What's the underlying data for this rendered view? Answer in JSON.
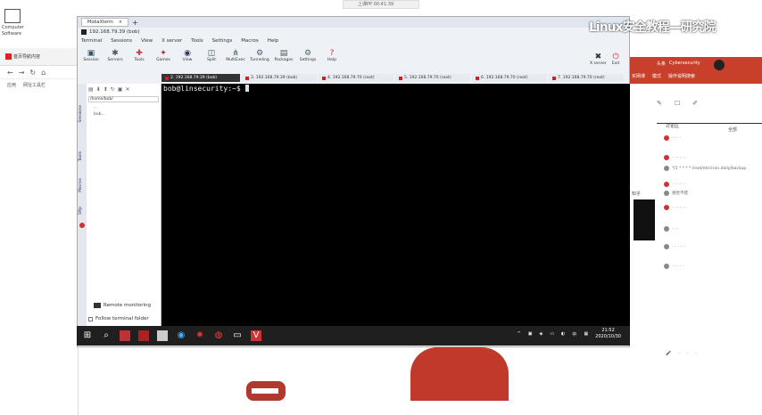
{
  "desktop": {
    "cam_strip": "上课PP 00:41:39",
    "icon_label": "Computer Software"
  },
  "watermark": "Linux安全教程—研究院",
  "left_browser": {
    "tab_label": "首页导航内容",
    "nav": [
      "←",
      "→",
      "↻",
      "⌂"
    ],
    "bookmarks": [
      "应用",
      "网址工具栏"
    ]
  },
  "moba": {
    "window_tab": "MobaXterm",
    "title": "192.168.79.39 (bob)",
    "menu": [
      "Terminal",
      "Sessions",
      "View",
      "X server",
      "Tools",
      "Settings",
      "Macros",
      "Help"
    ],
    "toolbar": [
      {
        "label": "Session",
        "icon": "session-icon",
        "glyph": "▣"
      },
      {
        "label": "Servers",
        "icon": "servers-icon",
        "glyph": "✱"
      },
      {
        "label": "Tools",
        "icon": "tools-icon",
        "glyph": "✚"
      },
      {
        "label": "Games",
        "icon": "games-icon",
        "glyph": "✦"
      },
      {
        "label": "View",
        "icon": "view-icon",
        "glyph": "◉"
      },
      {
        "label": "Split",
        "icon": "split-icon",
        "glyph": "◫"
      },
      {
        "label": "MultiExec",
        "icon": "multiexec-icon",
        "glyph": "⋔"
      },
      {
        "label": "Tunneling",
        "icon": "tunneling-icon",
        "glyph": "⚙"
      },
      {
        "label": "Packages",
        "icon": "packages-icon",
        "glyph": "▤"
      },
      {
        "label": "Settings",
        "icon": "settings-icon",
        "glyph": "⚙"
      },
      {
        "label": "Help",
        "icon": "help-icon",
        "glyph": "?"
      }
    ],
    "xserver_label": "X server",
    "exit_label": "Exit",
    "session_tabs": [
      {
        "label": "2. 192.168.79.39 (bob)",
        "active": true
      },
      {
        "label": "3. 192.168.79.39 (bob)",
        "active": false
      },
      {
        "label": "4. 192.168.79.70 (root)",
        "active": false
      },
      {
        "label": "5. 192.168.79.70 (root)",
        "active": false
      },
      {
        "label": "6. 192.168.79.70 (root)",
        "active": false
      },
      {
        "label": "7. 192.168.79.70 (root)",
        "active": false
      }
    ],
    "sidebar": {
      "path": "/home/bob/",
      "tree": [
        "..",
        "bob..."
      ],
      "side_tabs": [
        "Sessions",
        "Tools",
        "Macros",
        "Sftp"
      ],
      "remote_monitoring": "Remote monitoring",
      "follow_folder": "Follow terminal folder"
    },
    "terminal": {
      "prompt": "bob@linsecurity:~$ "
    }
  },
  "taskbar": {
    "time": "21:52",
    "date": "2020/10/30",
    "tray": [
      "^",
      "▣",
      "◈",
      "▭",
      "◐",
      "中",
      "▦"
    ]
  },
  "right_panel": {
    "top_tabs": [
      "头条",
      "Cybersecurity"
    ],
    "sub_tabs": [
      "实网课",
      "模式",
      "操作说明搜索"
    ],
    "discussion_title": "讨论区",
    "discussion_button": "全部",
    "items": [
      {
        "text": "· · · ·",
        "red": true
      },
      {
        "text": "· · · · · ·",
        "red": true
      },
      {
        "text": "*/1 * * * * /root/etc/cron.daily/backup",
        "red": false
      },
      {
        "text": "· · · · · ·",
        "red": true
      },
      {
        "text": "感觉不错",
        "red": false
      },
      {
        "text": "· · · · · ·",
        "red": true
      },
      {
        "text": "· · ·",
        "red": false
      },
      {
        "text": "· · · · · ·",
        "red": false
      },
      {
        "text": "· · · · ·",
        "red": false
      }
    ],
    "side_char": "知乎",
    "bottom_icons": [
      "🎤",
      "·",
      "·",
      "·"
    ]
  }
}
